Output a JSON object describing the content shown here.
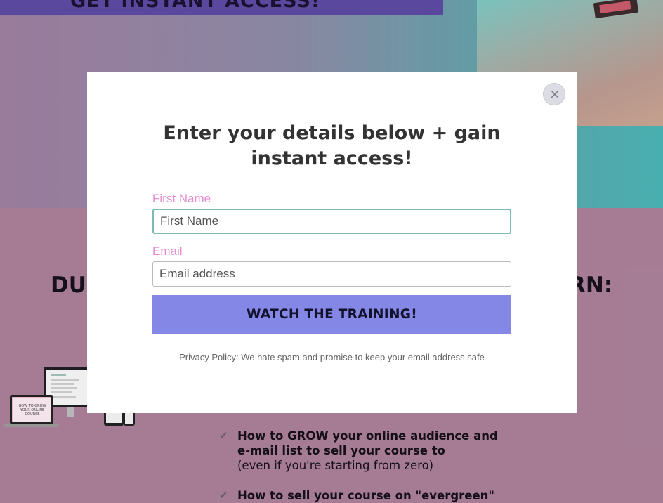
{
  "background": {
    "banner_text": "GET INSTANT ACCESS!",
    "heading_left": "DU",
    "heading_right": "RN:",
    "mockup_text": "HOW TO GROW YOUR ONLINE COURSE",
    "bullets": [
      {
        "title": "How to GROW your online audience and e-mail list to sell your course to",
        "subtitle": "(even if you're starting from zero)"
      },
      {
        "title": "How to sell your course on \"evergreen\"",
        "subtitle": ""
      }
    ],
    "check_glyph": "✔"
  },
  "modal": {
    "close_glyph": "×",
    "title": "Enter your details below + gain instant access!",
    "first_name_label": "First Name",
    "first_name_placeholder": "First Name",
    "first_name_value": "",
    "email_label": "Email",
    "email_placeholder": "Email address",
    "email_value": "",
    "submit_label": "WATCH THE TRAINING!",
    "privacy_text": "Privacy Policy: We hate spam and promise to keep your email address safe"
  },
  "colors": {
    "label_pink": "#e58cd0",
    "button_purple": "#8487e6",
    "page_mauve": "#a87f96",
    "teal_accent": "#49b3b3"
  }
}
